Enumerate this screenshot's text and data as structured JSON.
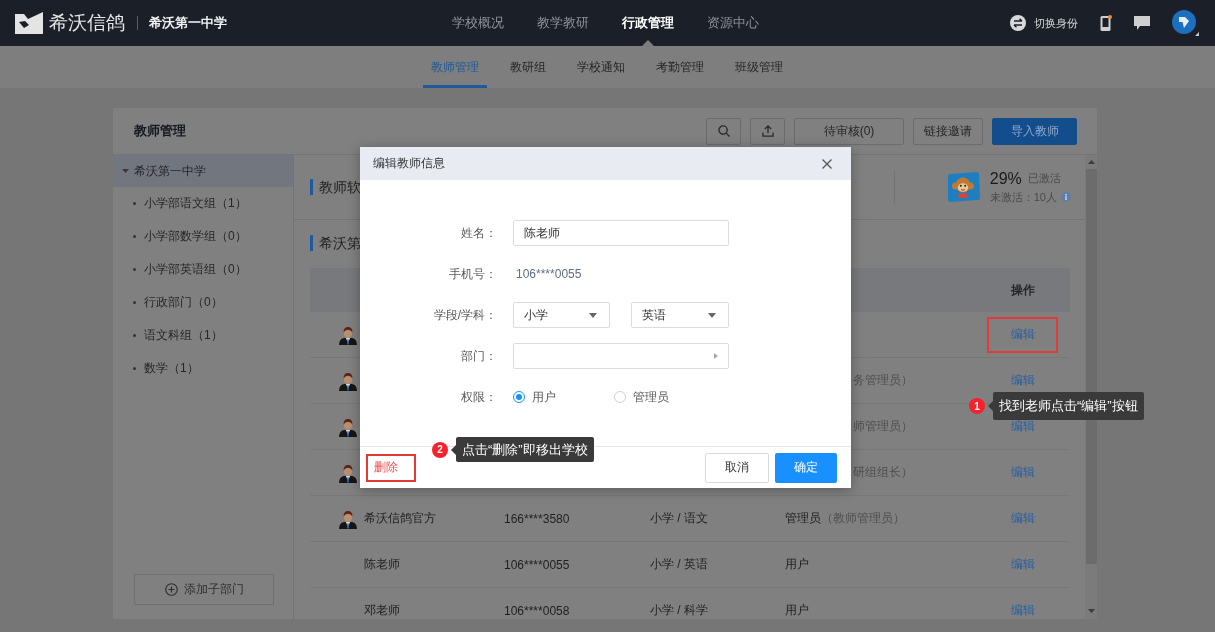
{
  "top_bar": {
    "brand": "希沃信鸽",
    "school": "希沃第一中学",
    "nav": [
      {
        "label": "学校概况",
        "selected": false
      },
      {
        "label": "教学教研",
        "selected": false
      },
      {
        "label": "行政管理",
        "selected": true
      },
      {
        "label": "资源中心",
        "selected": false
      }
    ],
    "switch_identity": "切换身份"
  },
  "sub_nav": [
    {
      "label": "教师管理",
      "selected": true
    },
    {
      "label": "教研组",
      "selected": false
    },
    {
      "label": "学校通知",
      "selected": false
    },
    {
      "label": "考勤管理",
      "selected": false
    },
    {
      "label": "班级管理",
      "selected": false
    }
  ],
  "panel": {
    "title": "教师管理",
    "actions": [
      {
        "kind": "default",
        "label": "待审核(0)"
      },
      {
        "kind": "default",
        "label": "链接邀请"
      },
      {
        "kind": "primary",
        "label": "导入教师"
      }
    ]
  },
  "departments": {
    "root": {
      "label": "希沃第一中学",
      "expanded": true,
      "selected": true,
      "children": [
        {
          "label": "小学部语文组（1）",
          "selected": false
        },
        {
          "label": "小学部数学组（0）",
          "selected": false
        },
        {
          "label": "小学部英语组（0）",
          "selected": false
        },
        {
          "label": "行政部门（0）",
          "selected": false
        },
        {
          "label": "语文科组（1）",
          "selected": false
        },
        {
          "label": "数学（1）",
          "selected": false
        }
      ]
    },
    "add_button": "添加子部门"
  },
  "stats_section": {
    "title": "教师软",
    "percent": "29%",
    "activated_label": "已激活",
    "inactive": "未激活：10人"
  },
  "teacher_list": {
    "title": "希沃第",
    "action_header": "操作",
    "rows": [
      {
        "kind": "partial",
        "avatar": true,
        "action": "编辑",
        "highlighted": true
      },
      {
        "kind": "partial",
        "avatar": true,
        "role_note": "务管理员）",
        "action": "编辑",
        "highlighted": false
      },
      {
        "kind": "partial",
        "avatar": true,
        "role_note": "师管理员）",
        "action": "编辑",
        "highlighted": false
      },
      {
        "kind": "partial",
        "avatar": true,
        "role_note": "研组组长）",
        "action": "编辑",
        "highlighted": false
      },
      {
        "kind": "full",
        "avatar": true,
        "name": "希沃信鸽官方",
        "phone": "166****3580",
        "subject": "小学 / 语文",
        "role": "管理员",
        "role_note": "（教师管理员）",
        "action": "编辑",
        "highlighted": false
      },
      {
        "kind": "full",
        "avatar": false,
        "name": "陈老师",
        "phone": "106****0055",
        "subject": "小学 / 英语",
        "role": "用户",
        "action": "编辑",
        "highlighted": false
      },
      {
        "kind": "full",
        "avatar": false,
        "name": "邓老师",
        "phone": "106****0058",
        "subject": "小学 / 科学",
        "role": "用户",
        "action": "编辑",
        "highlighted": false
      }
    ]
  },
  "dialog": {
    "title": "编辑教师信息",
    "fields": [
      {
        "kind": "input",
        "label": "姓名：",
        "value": "陈老师"
      },
      {
        "kind": "text",
        "label": "手机号：",
        "value": "106****0055"
      },
      {
        "kind": "selects",
        "label": "学段/学科：",
        "values": [
          "小学",
          "英语"
        ]
      },
      {
        "kind": "picker",
        "label": "部门："
      },
      {
        "kind": "radio",
        "label": "权限：",
        "options": [
          {
            "label": "用户",
            "selected": true
          },
          {
            "label": "管理员",
            "selected": false
          }
        ]
      }
    ],
    "delete": {
      "label": "删除",
      "highlighted": true
    },
    "cancel": "取消",
    "confirm": "确定"
  },
  "annotations": [
    {
      "number": "1",
      "text": "找到老师点击“编辑”按钮"
    },
    {
      "number": "2",
      "text": "点击“删除”即移出学校"
    }
  ]
}
